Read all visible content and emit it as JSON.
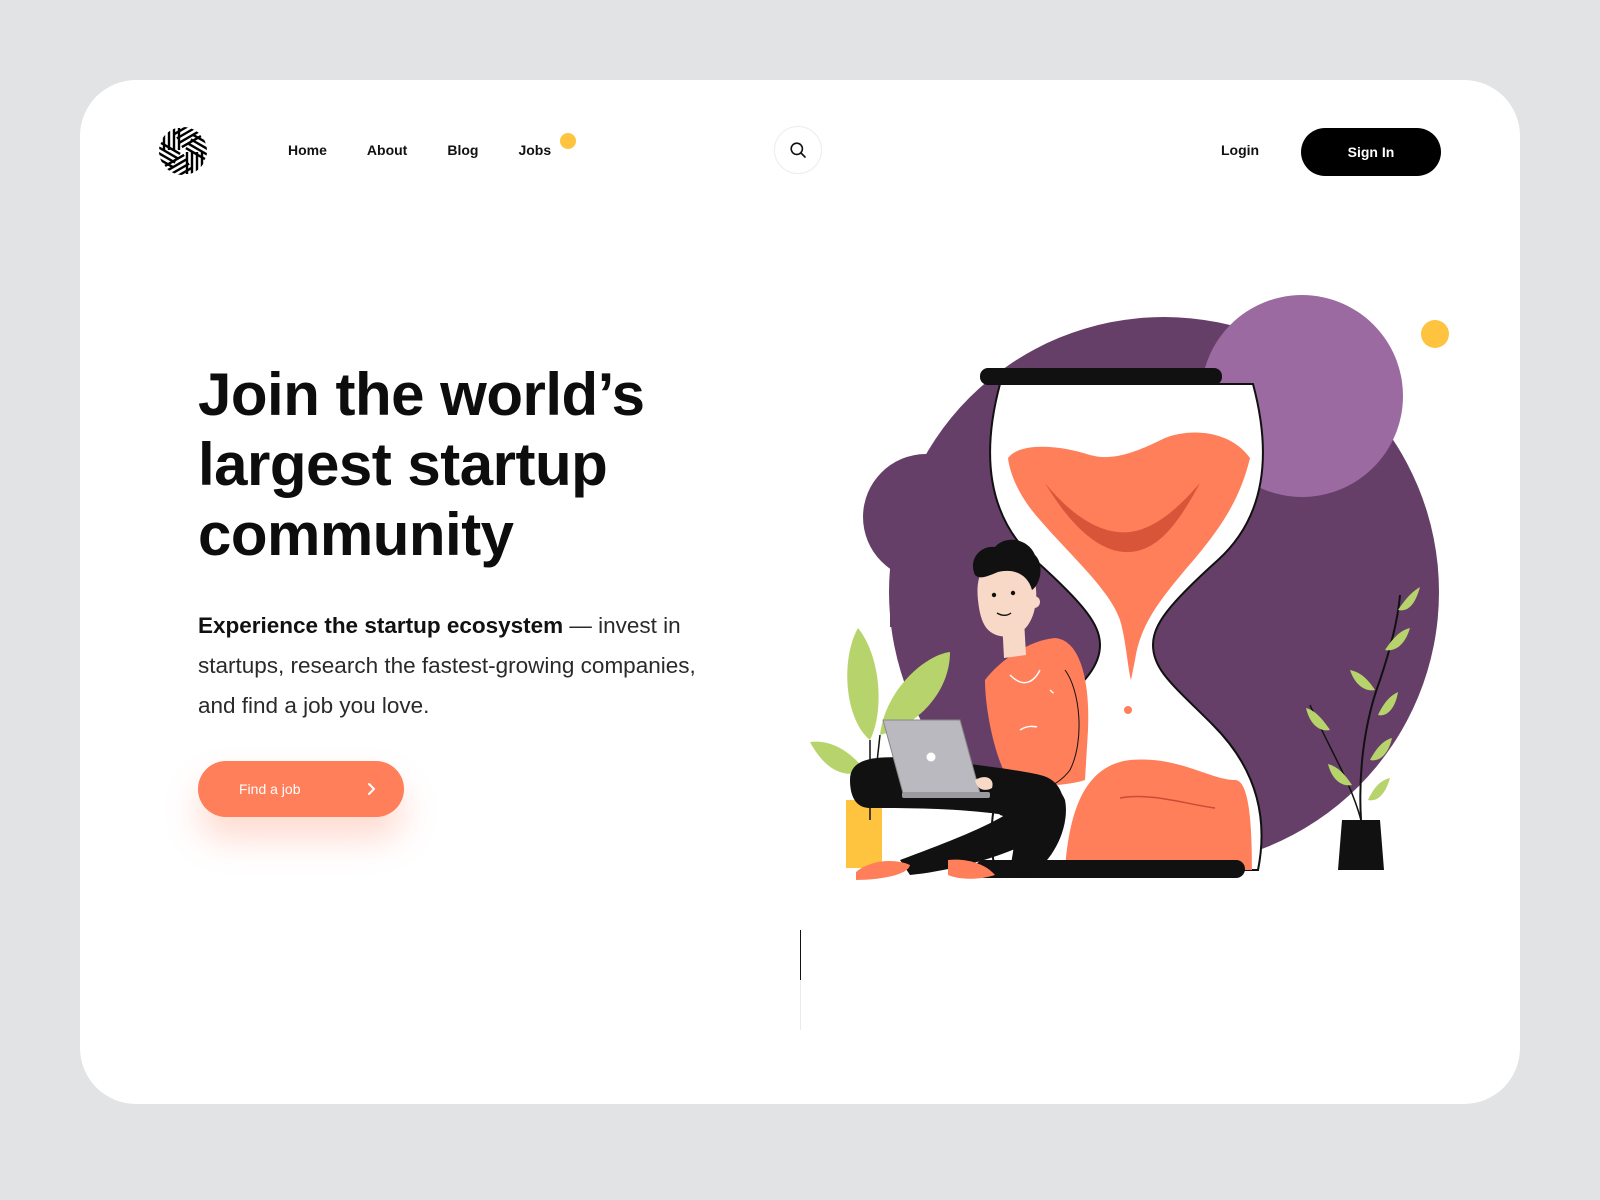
{
  "nav": {
    "home": "Home",
    "about": "About",
    "blog": "Blog",
    "jobs": "Jobs"
  },
  "header": {
    "login": "Login",
    "signin": "Sign In"
  },
  "hero": {
    "title_line1": "Join the world’s",
    "title_line2": "largest startup",
    "title_line3": "community",
    "subtitle_strong": "Experience the startup ecosystem",
    "subtitle_rest": " — invest in startups, research the fastest-growing companies, and find a job you love.",
    "cta_label": "Find a job"
  },
  "icons": {
    "logo": "logo-icon",
    "search": "search-icon",
    "cta": "chevron-right-icon"
  },
  "colors": {
    "accent": "#ff7f5a",
    "purple_dark": "#663f69",
    "purple_light": "#9b6aa0",
    "yellow": "#fec33f",
    "background": "#e2e3e5"
  }
}
